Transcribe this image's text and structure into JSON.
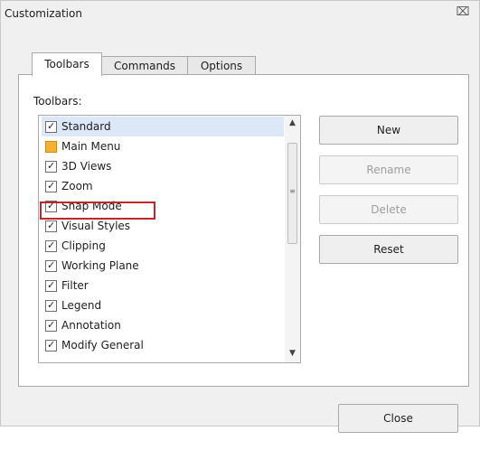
{
  "window": {
    "title": "Customization"
  },
  "tabs": [
    {
      "label": "Toolbars",
      "active": true
    },
    {
      "label": "Commands",
      "active": false
    },
    {
      "label": "Options",
      "active": false
    }
  ],
  "toolbars_panel": {
    "section_label": "Toolbars:",
    "items": [
      {
        "label": "Standard",
        "checked": true,
        "selected": true
      },
      {
        "label": "Main Menu",
        "checked": true,
        "icon": "orange-square-icon"
      },
      {
        "label": "3D Views",
        "checked": true
      },
      {
        "label": "Zoom",
        "checked": true
      },
      {
        "label": "Snap Mode",
        "checked": true,
        "highlighted": true
      },
      {
        "label": "Visual Styles",
        "checked": true
      },
      {
        "label": "Clipping",
        "checked": true
      },
      {
        "label": "Working Plane",
        "checked": true
      },
      {
        "label": "Filter",
        "checked": true
      },
      {
        "label": "Legend",
        "checked": true
      },
      {
        "label": "Annotation",
        "checked": true
      },
      {
        "label": "Modify General",
        "checked": true
      }
    ]
  },
  "buttons": {
    "new": "New",
    "rename": "Rename",
    "delete": "Delete",
    "reset": "Reset",
    "close": "Close"
  },
  "colors": {
    "highlight_box": "#c0272d",
    "selected_row": "#dce8f7",
    "main_menu_icon": "#f5b22e"
  },
  "icons": {
    "close": "close-icon",
    "checkbox": "checkbox-checked-icon",
    "main_menu": "orange-square-icon",
    "scroll_up": "scroll-up-arrow-icon",
    "scroll_down": "scroll-down-arrow-icon"
  }
}
